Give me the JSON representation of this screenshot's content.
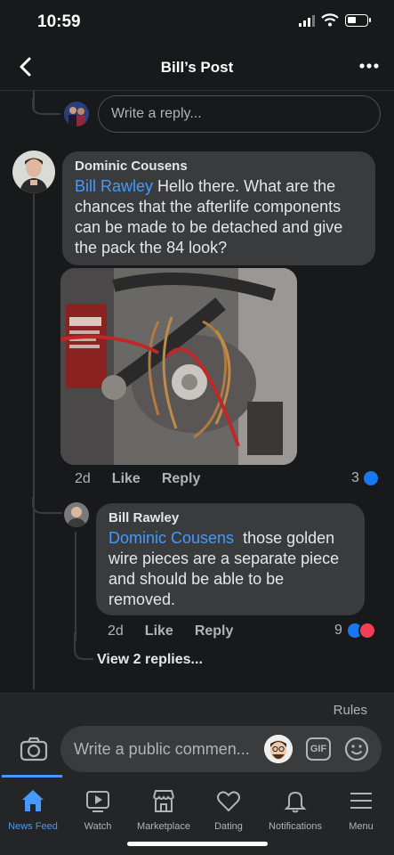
{
  "status_bar": {
    "time": "10:59"
  },
  "header": {
    "title": "Bill’s Post"
  },
  "reply_input": {
    "placeholder": "Write a reply..."
  },
  "comment_1": {
    "author": "Dominic Cousens",
    "mention": "Bill Rawley",
    "text": " Hello there. What are the chances that the afterlife components can be made to be detached and give the pack the 84 look?",
    "time": "2d",
    "like_label": "Like",
    "reply_label": "Reply",
    "reaction_count": "3"
  },
  "comment_2": {
    "author": "Bill Rawley",
    "mention": "Dominic Cousens",
    "text": "  those golden wire pieces are a separate piece and should be able to be removed.",
    "time": "2d",
    "like_label": "Like",
    "reply_label": "Reply",
    "reaction_count": "9"
  },
  "view_replies": "View 2 replies...",
  "composer": {
    "rules": "Rules",
    "placeholder": "Write a public commen...",
    "gif_label": "GIF"
  },
  "tabs": [
    {
      "label": "News Feed",
      "icon": "home-icon",
      "active": true
    },
    {
      "label": "Watch",
      "icon": "watch-icon"
    },
    {
      "label": "Marketplace",
      "icon": "marketplace-icon"
    },
    {
      "label": "Dating",
      "icon": "dating-icon"
    },
    {
      "label": "Notifications",
      "icon": "bell-icon"
    },
    {
      "label": "Menu",
      "icon": "menu-icon"
    }
  ],
  "colors": {
    "accent": "#4599ff",
    "background": "#18191a",
    "bubble": "#3a3b3c",
    "love": "#f33e58"
  }
}
